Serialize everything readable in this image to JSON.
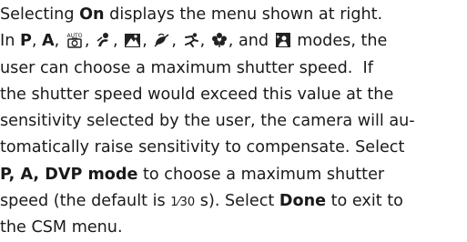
{
  "lines": {
    "l1": {
      "text": "Selecting ",
      "bold": "On",
      "rest": " displays the menu shown at right."
    },
    "l2": {
      "start": "In ",
      "p": "P",
      "comma1": ", ",
      "a": "A",
      "comma2": ", ",
      "rest": " modes, the"
    },
    "l3": "user can choose a maximum shutter speed.  If",
    "l4": "the shutter speed would exceed this value at the",
    "l5": "sensitivity selected by the user, the camera will au-",
    "l6": "tomatically raise sensitivity to compensate.  Select",
    "l7": {
      "bold": "P, A, DVP mode",
      "rest": " to choose a maximum shutter"
    },
    "l8": {
      "start": "speed (the default is ",
      "fraction": "1⁄30",
      "unit": " s).  Select ",
      "bold": "Done",
      "rest": " to exit to"
    },
    "l9": "the CSM menu."
  },
  "icons": {
    "auto": "auto-scene-icon",
    "portrait": "portrait-icon",
    "landscape": "landscape-icon",
    "closeup": "close-up-icon",
    "sports": "sports-icon",
    "flower": "flower-icon",
    "night": "night-portrait-icon"
  }
}
